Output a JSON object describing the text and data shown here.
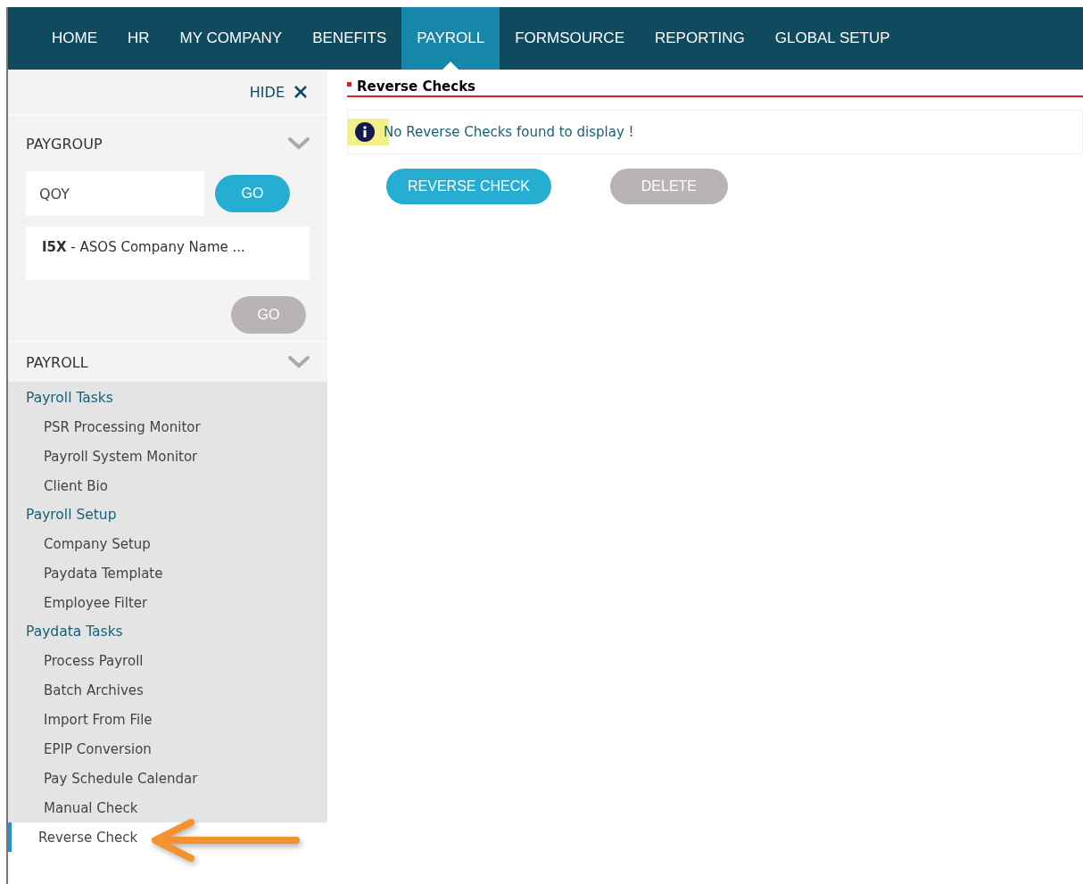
{
  "nav": [
    {
      "label": "HOME",
      "selected": false
    },
    {
      "label": "HR",
      "selected": false
    },
    {
      "label": "MY COMPANY",
      "selected": false
    },
    {
      "label": "BENEFITS",
      "selected": false
    },
    {
      "label": "PAYROLL",
      "selected": true
    },
    {
      "label": "FORMSOURCE",
      "selected": false
    },
    {
      "label": "REPORTING",
      "selected": false
    },
    {
      "label": "GLOBAL SETUP",
      "selected": false
    }
  ],
  "sidebar": {
    "hide_label": "HIDE",
    "paygroup": {
      "title": "PAYGROUP",
      "code_value": "QOY",
      "go_button": {
        "label": "GO",
        "disabled": false
      },
      "company": {
        "code": "I5X",
        "name": " - ASOS Company Name ..."
      },
      "second_go_button": {
        "label": "GO",
        "disabled": true
      }
    },
    "payroll": {
      "title": "PAYROLL",
      "groups": [
        {
          "label": "Payroll Tasks",
          "children": [
            {
              "label": "PSR Processing Monitor",
              "selected": false
            },
            {
              "label": "Payroll System Monitor",
              "selected": false
            },
            {
              "label": "Client Bio",
              "selected": false
            }
          ]
        },
        {
          "label": "Payroll Setup",
          "children": [
            {
              "label": "Company Setup",
              "selected": false
            },
            {
              "label": "Paydata Template",
              "selected": false
            },
            {
              "label": "Employee Filter",
              "selected": false
            }
          ]
        },
        {
          "label": "Paydata Tasks",
          "children": [
            {
              "label": "Process Payroll",
              "selected": false
            },
            {
              "label": "Batch Archives",
              "selected": false
            },
            {
              "label": "Import From File",
              "selected": false
            },
            {
              "label": "EPIP Conversion",
              "selected": false
            },
            {
              "label": "Pay Schedule Calendar",
              "selected": false
            },
            {
              "label": "Manual Check",
              "selected": false
            },
            {
              "label": "Reverse Check",
              "selected": true
            }
          ]
        }
      ]
    }
  },
  "main": {
    "title": "Reverse Checks",
    "message": "No Reverse Checks found to display !",
    "buttons": [
      {
        "label": "REVERSE CHECK",
        "disabled": false
      },
      {
        "label": "DELETE",
        "disabled": true
      }
    ]
  }
}
